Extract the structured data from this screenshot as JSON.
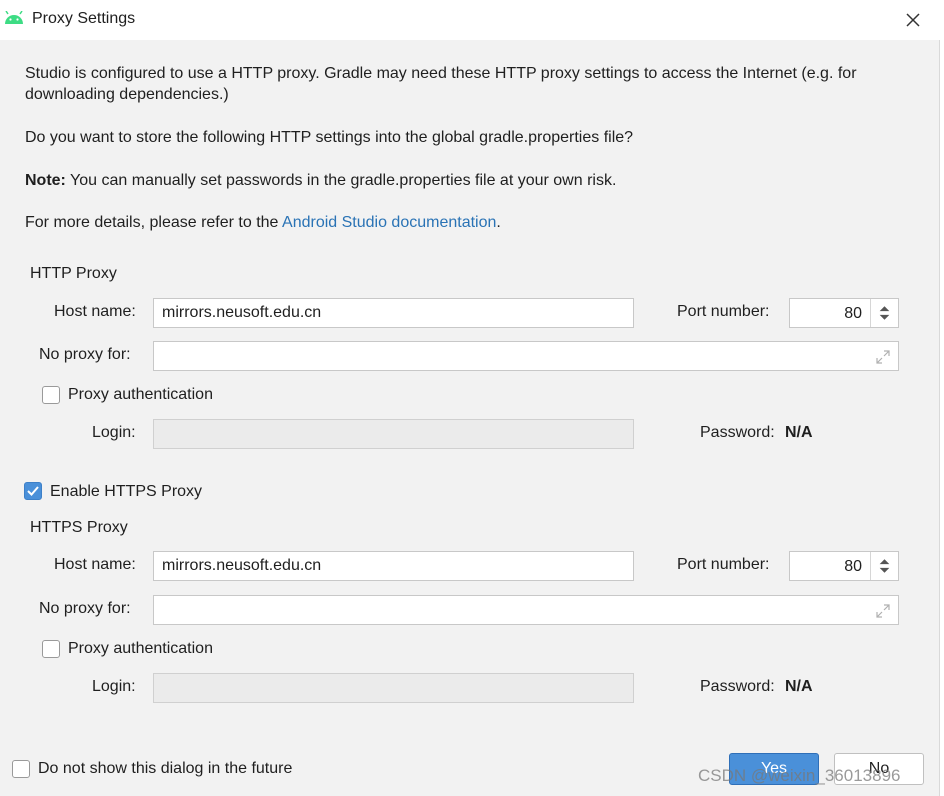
{
  "window": {
    "title": "Proxy Settings",
    "app_icon": "android-icon",
    "close_icon": "close-icon"
  },
  "intro": {
    "line1": "Studio is configured to use a HTTP proxy. Gradle may need these HTTP proxy settings to access the Internet (e.g. for downloading dependencies.)",
    "question": "Do you want to store the following HTTP settings into the global gradle.properties file?",
    "note_label": "Note:",
    "note_text": " You can manually set passwords in the gradle.properties file at your own risk.",
    "details_prefix": "For more details, please refer to the ",
    "details_link": "Android Studio documentation",
    "details_suffix": "."
  },
  "http": {
    "section_label": "HTTP Proxy",
    "host_label": "Host name:",
    "host_value": "mirrors.neusoft.edu.cn",
    "port_label": "Port number:",
    "port_value": "80",
    "no_proxy_label": "No proxy for:",
    "no_proxy_value": "",
    "auth_label": "Proxy authentication",
    "auth_checked": false,
    "login_label": "Login:",
    "login_value": "",
    "password_label": "Password:",
    "password_value": "N/A"
  },
  "https_toggle": {
    "label": "Enable HTTPS Proxy",
    "checked": true
  },
  "https": {
    "section_label": "HTTPS Proxy",
    "host_label": "Host name:",
    "host_value": "mirrors.neusoft.edu.cn",
    "port_label": "Port number:",
    "port_value": "80",
    "no_proxy_label": "No proxy for:",
    "no_proxy_value": "",
    "auth_label": "Proxy authentication",
    "auth_checked": false,
    "login_label": "Login:",
    "login_value": "",
    "password_label": "Password:",
    "password_value": "N/A"
  },
  "footer": {
    "dont_show_label": "Do not show this dialog in the future",
    "dont_show_checked": false,
    "yes_label": "Yes",
    "no_label": "No"
  },
  "watermark": "CSDN @weixin_36013896",
  "colors": {
    "accent": "#4a90d9",
    "link": "#2a73b5",
    "android_green": "#3ddc84"
  }
}
